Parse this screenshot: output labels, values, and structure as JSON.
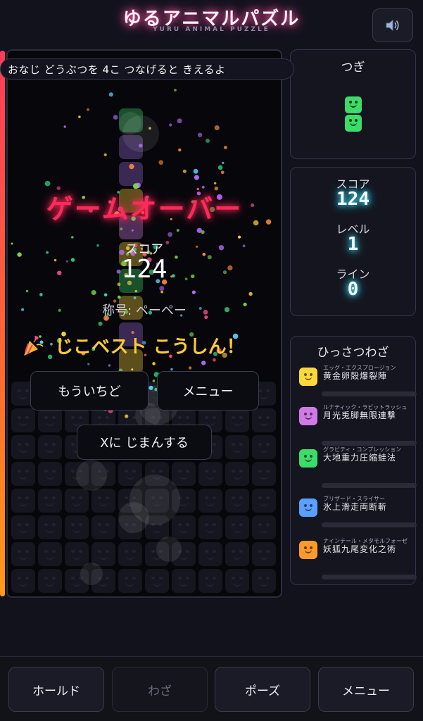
{
  "header": {
    "title": "ゆるアニマルパズル",
    "subtitle": "YURU ANIMAL PUZZLE",
    "sound_icon": "speaker-icon"
  },
  "board": {
    "hint": "おなじ どうぶつを 4こ つなげると きえるよ"
  },
  "game_over": {
    "title": "ゲームオーバー",
    "score_label": "スコア",
    "score_value": "124",
    "rank": "称号: ペーペー",
    "best_icon": "party-popper-icon",
    "best_text": "じこベスト こうしん！",
    "retry_label": "もういちど",
    "menu_label": "メニュー",
    "share_label": "Xに じまんする"
  },
  "next": {
    "title": "つぎ",
    "pieces": [
      "frog",
      "frog"
    ],
    "piece_color": "#3cdc6a"
  },
  "stats": {
    "score_label": "スコア",
    "score_value": "124",
    "level_label": "レベル",
    "level_value": "1",
    "lines_label": "ライン",
    "lines_value": "0",
    "glow_color": "#33e0ff"
  },
  "skills": {
    "title": "ひっさつわざ",
    "items": [
      {
        "animal": "chick",
        "color": "#ffd83a",
        "sub": "エッグ・エクスプロージョン",
        "name": "黄金卵殻爆裂陣",
        "progress": 0
      },
      {
        "animal": "rabbit",
        "color": "#d07ae8",
        "sub": "ルナティック・ラビットラッシュ",
        "name": "月光兎脚無限連撃",
        "progress": 0
      },
      {
        "animal": "frog",
        "color": "#3cdc6a",
        "sub": "グラビティ・コンプレッション",
        "name": "大地重力圧縮蛙法",
        "progress": 0
      },
      {
        "animal": "penguin",
        "color": "#5aa0ff",
        "sub": "ブリザード・スライサー",
        "name": "氷上滑走両断斬",
        "progress": 0
      },
      {
        "animal": "fox",
        "color": "#ff9a2a",
        "sub": "ナインテール・メタモルフォーゼ",
        "name": "妖狐九尾変化之術",
        "progress": 0
      }
    ]
  },
  "bottom": {
    "hold_label": "ホールド",
    "skill_label": "わざ",
    "pause_label": "ポーズ",
    "menu_label": "メニュー"
  },
  "colors": {
    "title_glow": "#ff4fa0",
    "game_over": "#ff2a5a",
    "best": "#ffcc33"
  }
}
